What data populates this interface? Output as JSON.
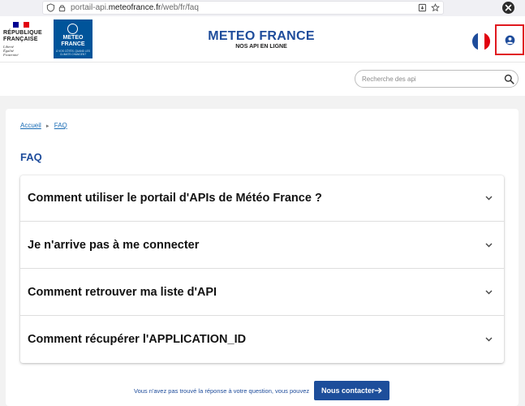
{
  "browser": {
    "url_prefix": "portail-api.",
    "url_domain": "meteofrance.fr",
    "url_path": "/web/fr/faq"
  },
  "header": {
    "republique_line1": "RÉPUBLIQUE",
    "republique_line2": "FRANÇAISE",
    "motto_1": "Liberté",
    "motto_2": "Égalité",
    "motto_3": "Fraternité",
    "logo_line1": "METEO",
    "logo_line2": "FRANCE",
    "logo_tagline": "À VOS CÔTÉS, QUAND LES CLIMATS CHANGENT",
    "site_title": "METEO FRANCE",
    "site_subtitle": "NOS API EN LIGNE"
  },
  "search": {
    "placeholder": "Recherche des api"
  },
  "breadcrumb": {
    "home": "Accueil",
    "separator": "►",
    "current": "FAQ"
  },
  "page_title": "FAQ",
  "faq": {
    "items": [
      {
        "question": "Comment utiliser le portail d'APIs de Météo France ?"
      },
      {
        "question": "Je n'arrive pas à me connecter"
      },
      {
        "question": "Comment retrouver ma liste d'API"
      },
      {
        "question": "Comment récupérer l'APPLICATION_ID"
      }
    ]
  },
  "footer": {
    "prompt": "Vous n'avez pas trouvé la réponse à votre question, vous pouvez",
    "contact_label": "Nous contacter"
  },
  "colors": {
    "brand_blue": "#1e4c9b",
    "logo_blue": "#00549a",
    "highlight_red": "#e0191f",
    "flag_blue": "#000091",
    "flag_red": "#e1000f"
  },
  "icons": {
    "shield": "shield-icon",
    "lock": "lock-icon",
    "download": "download-icon",
    "star": "star-icon",
    "close": "close-icon",
    "user": "user-account-icon",
    "search": "search-icon",
    "chevron": "chevron-down-icon",
    "arrow": "arrow-right-icon"
  }
}
